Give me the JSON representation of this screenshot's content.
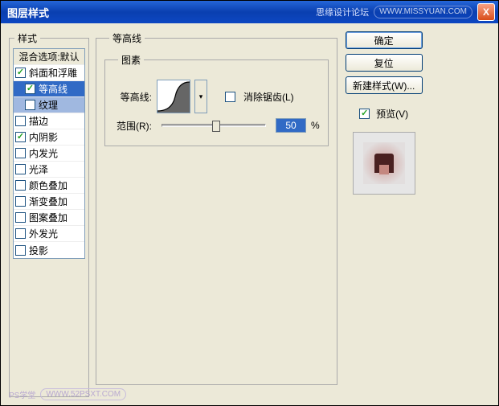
{
  "titlebar": {
    "title": "图层样式",
    "wm_text": "思缘设计论坛",
    "wm_url": "WWW.MISSYUAN.COM",
    "close": "X"
  },
  "styles_panel": {
    "legend": "样式",
    "header": "混合选项:默认",
    "items": [
      {
        "label": "斜面和浮雕",
        "checked": true,
        "selected": false,
        "indent": 0
      },
      {
        "label": "等高线",
        "checked": true,
        "selected": true,
        "indent": 1
      },
      {
        "label": "纹理",
        "checked": false,
        "selected": false,
        "sub_selected": true,
        "indent": 1
      },
      {
        "label": "描边",
        "checked": false,
        "selected": false,
        "indent": 0
      },
      {
        "label": "内阴影",
        "checked": true,
        "selected": false,
        "indent": 0
      },
      {
        "label": "内发光",
        "checked": false,
        "selected": false,
        "indent": 0
      },
      {
        "label": "光泽",
        "checked": false,
        "selected": false,
        "indent": 0
      },
      {
        "label": "颜色叠加",
        "checked": false,
        "selected": false,
        "indent": 0
      },
      {
        "label": "渐变叠加",
        "checked": false,
        "selected": false,
        "indent": 0
      },
      {
        "label": "图案叠加",
        "checked": false,
        "selected": false,
        "indent": 0
      },
      {
        "label": "外发光",
        "checked": false,
        "selected": false,
        "indent": 0
      },
      {
        "label": "投影",
        "checked": false,
        "selected": false,
        "indent": 0
      }
    ]
  },
  "center": {
    "legend": "等高线",
    "inner_legend": "图素",
    "contour_label": "等高线:",
    "antialias_label": "消除锯齿(L)",
    "range_label": "范围(R):",
    "range_value": "50",
    "percent": "%",
    "dd_glyph": "▾"
  },
  "buttons": {
    "ok": "确定",
    "cancel": "复位",
    "new_style": "新建样式(W)...",
    "preview": "预览(V)"
  },
  "footer": {
    "text": "PS学堂",
    "url": "WWW.52PSXT.COM"
  }
}
